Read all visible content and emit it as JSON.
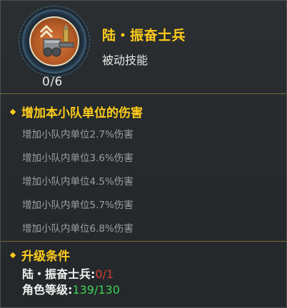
{
  "skill": {
    "name": "陆・振奋士兵",
    "type": "被动技能",
    "level": "0/6",
    "icon": "artillery-cannon-icon"
  },
  "effects": {
    "title": "增加本小队单位的伤害",
    "items": [
      "增加小队内单位2.7%伤害",
      "增加小队内单位3.6%伤害",
      "增加小队内单位4.5%伤害",
      "增加小队内单位5.7%伤害",
      "增加小队内单位6.8%伤害"
    ]
  },
  "upgrade": {
    "title": "升级条件",
    "requirements": [
      {
        "label": "陆・振奋士兵:",
        "current": "0",
        "required": "/1",
        "status": "unmet"
      },
      {
        "label": "角色等级:",
        "current": "139",
        "required": "/130",
        "status": "met"
      }
    ]
  },
  "colors": {
    "accent": "#ffcc1a",
    "unmet": "#d43a3a",
    "met": "#3ecf5a"
  }
}
